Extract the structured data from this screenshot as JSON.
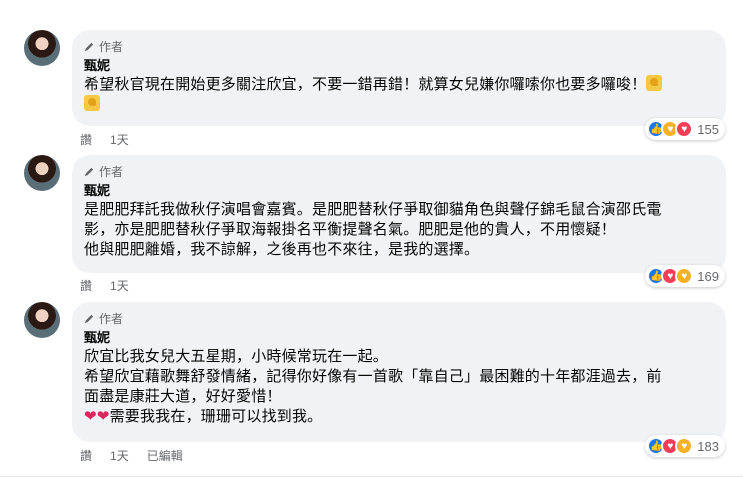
{
  "author_badge": "作者",
  "comments": [
    {
      "name": "甄妮",
      "lines": [
        "希望秋官現在開始更多關注欣宜，不要一錯再錯！就算女兒嫌你囉嗦你也要多囉唆！"
      ],
      "actions": [
        "讚",
        "1天"
      ],
      "reaction_count": "155",
      "reactions": [
        "like-icon",
        "care-icon",
        "love-icon"
      ]
    },
    {
      "name": "甄妮",
      "lines": [
        "是肥肥拜託我做秋仔演唱會嘉賓。是肥肥替秋仔爭取御貓角色與聲仔錦毛鼠合演邵氏電",
        "影，亦是肥肥替秋仔爭取海報掛名平衡提聲名氣。肥肥是他的貴人，不用懷疑！",
        "他與肥肥離婚，我不諒解，之後再也不來往，是我的選擇。"
      ],
      "actions": [
        "讚",
        "1天"
      ],
      "reaction_count": "169",
      "reactions": [
        "like-icon",
        "love-icon",
        "care-icon"
      ]
    },
    {
      "name": "甄妮",
      "lines": [
        "欣宜比我女兒大五星期，小時候常玩在一起。",
        "希望欣宜藉歌舞舒發情緒，記得你好像有一首歌「靠自己」最困難的十年都涯過去，前",
        "面盡是康莊大道，好好愛惜！",
        "需要我我在，珊珊可以找到我。"
      ],
      "actions": [
        "讚",
        "1天",
        "已編輯"
      ],
      "reaction_count": "183",
      "reactions": [
        "like-icon",
        "love-icon",
        "care-icon"
      ]
    }
  ]
}
